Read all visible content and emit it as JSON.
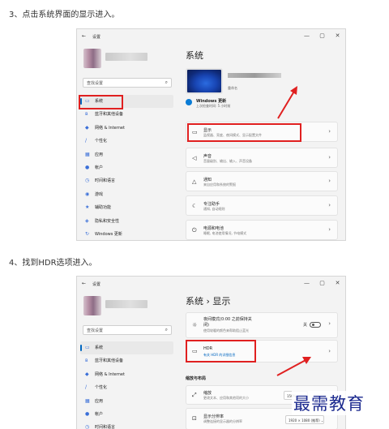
{
  "steps": [
    {
      "text": "3、点击系统界面的显示进入。"
    },
    {
      "text": "4、找到HDR选项进入。"
    }
  ],
  "window": {
    "title": "设置",
    "search_placeholder": "查找设置",
    "controls": [
      "—",
      "▢",
      "✕"
    ]
  },
  "sidebar": {
    "items": [
      {
        "label": "系统",
        "icon": "display-icon"
      },
      {
        "label": "蓝牙和其他设备",
        "icon": "bluetooth-icon"
      },
      {
        "label": "网络 & Internet",
        "icon": "network-icon"
      },
      {
        "label": "个性化",
        "icon": "brush-icon"
      },
      {
        "label": "应用",
        "icon": "apps-icon"
      },
      {
        "label": "帐户",
        "icon": "account-icon"
      },
      {
        "label": "时间和语言",
        "icon": "clock-icon"
      },
      {
        "label": "游戏",
        "icon": "gamepad-icon"
      },
      {
        "label": "辅助功能",
        "icon": "accessibility-icon"
      },
      {
        "label": "隐私和安全性",
        "icon": "shield-icon"
      },
      {
        "label": "Windows 更新",
        "icon": "update-icon"
      }
    ]
  },
  "screen1": {
    "title": "系统",
    "device_sub": "重命名",
    "windows_update": {
      "title": "Windows 更新",
      "subtitle": "上次检查时间: 5 小时前"
    },
    "cards": [
      {
        "title": "显示",
        "subtitle": "监视器、亮度、夜间模式、显示配置文件",
        "icon": "monitor-icon"
      },
      {
        "title": "声音",
        "subtitle": "音量级别、输出、输入、声音设备",
        "icon": "speaker-icon"
      },
      {
        "title": "通知",
        "subtitle": "来自应用和系统的警报",
        "icon": "bell-icon"
      },
      {
        "title": "专注助手",
        "subtitle": "通知, 自动规则",
        "icon": "moon-icon"
      },
      {
        "title": "电源和电池",
        "subtitle": "睡眠, 电池使用情况, 节电模式",
        "icon": "power-icon"
      }
    ]
  },
  "screen2": {
    "breadcrumb_parent": "系统",
    "breadcrumb_sep": "›",
    "breadcrumb_current": "显示",
    "night_light": {
      "title": "夜间模式(0:00 之前保持关",
      "title2": "闭)",
      "subtitle": "使用较暖的颜色来帮助阻止蓝光",
      "state": "关"
    },
    "hdr": {
      "title": "HDR",
      "subtitle": "有关 HDR 的详细信息"
    },
    "section": "缩放与布局",
    "scale": {
      "title": "缩放",
      "subtitle": "更改文本、应用和其他项的大小",
      "value": "150%"
    },
    "resolution": {
      "title": "显示分辨率",
      "subtitle": "调整连接的显示器的分辨率",
      "value": "1920 × 1080 (推荐)"
    }
  },
  "watermark": "最需教育",
  "colors": {
    "accent": "#0067c0",
    "highlight_box": "#e02020",
    "watermark": "#1c2a8f"
  }
}
